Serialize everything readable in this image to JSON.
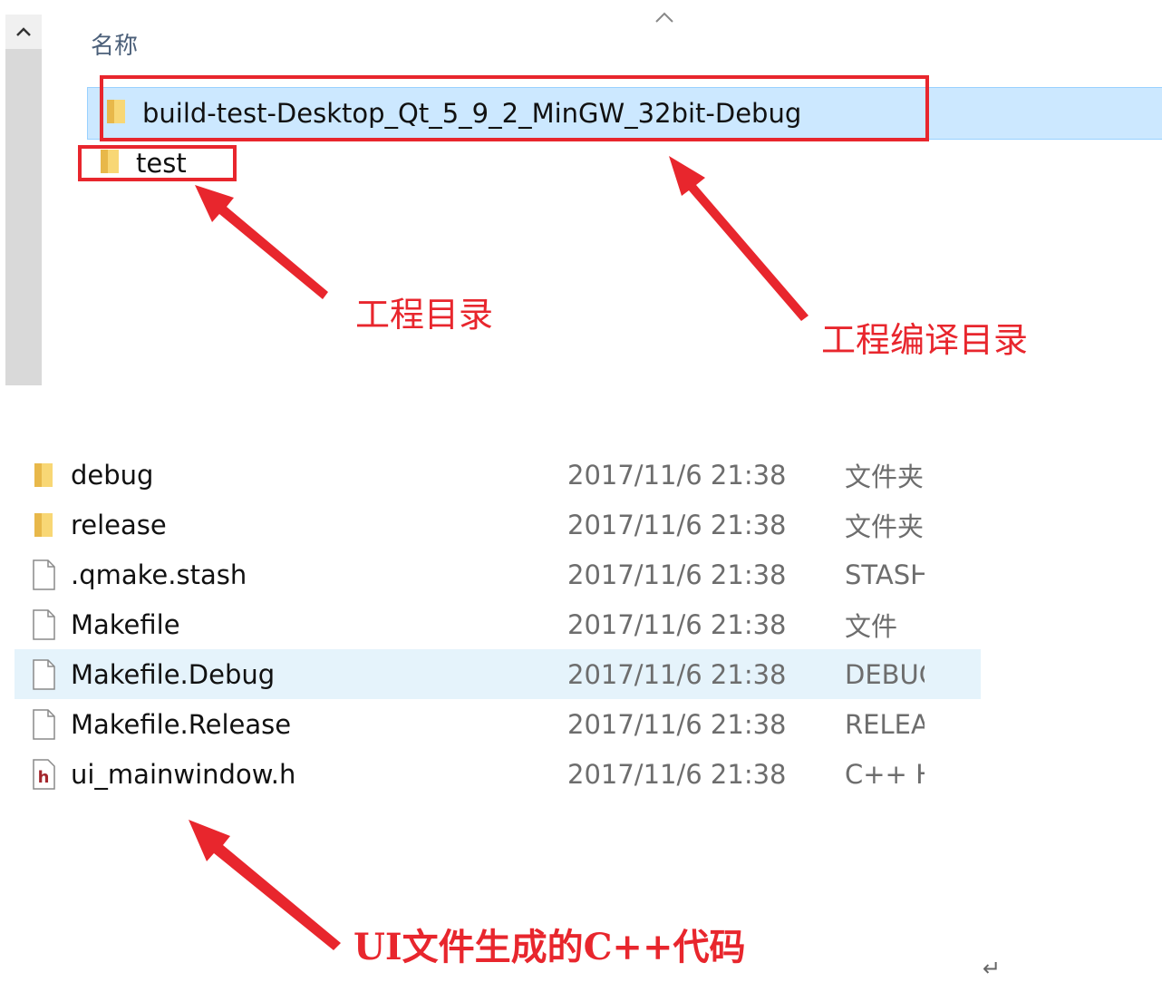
{
  "top_panel": {
    "column_header": "名称",
    "folders": [
      {
        "name": "build-test-Desktop_Qt_5_9_2_MinGW_32bit-Debug",
        "icon": "folder-icon",
        "selected": true
      },
      {
        "name": "test",
        "icon": "folder-icon",
        "selected": false
      }
    ]
  },
  "annotations": {
    "project_dir": "工程目录",
    "build_dir": "工程编译目录",
    "ui_code": "UI文件生成的C++代码",
    "return_mark": "↵"
  },
  "file_list": {
    "rows": [
      {
        "name": "debug",
        "date": "2017/11/6 21:38",
        "type": "文件夹",
        "icon": "folder-icon"
      },
      {
        "name": "release",
        "date": "2017/11/6 21:38",
        "type": "文件夹",
        "icon": "folder-icon"
      },
      {
        "name": ".qmake.stash",
        "date": "2017/11/6 21:38",
        "type": "STASH",
        "icon": "file-icon"
      },
      {
        "name": "Makefile",
        "date": "2017/11/6 21:38",
        "type": "文件",
        "icon": "file-icon"
      },
      {
        "name": "Makefile.Debug",
        "date": "2017/11/6 21:38",
        "type": "DEBUG",
        "icon": "file-icon",
        "selected": true
      },
      {
        "name": "Makefile.Release",
        "date": "2017/11/6 21:38",
        "type": "RELEASE",
        "icon": "file-icon"
      },
      {
        "name": "ui_mainwindow.h",
        "date": "2017/11/6 21:38",
        "type": "C++ H",
        "icon": "header-file-icon"
      }
    ]
  },
  "colors": {
    "selection": "#cce8ff",
    "hover": "#e5f3fb",
    "annotation_red": "#e8262d",
    "folder_yellow": "#f8d775"
  }
}
